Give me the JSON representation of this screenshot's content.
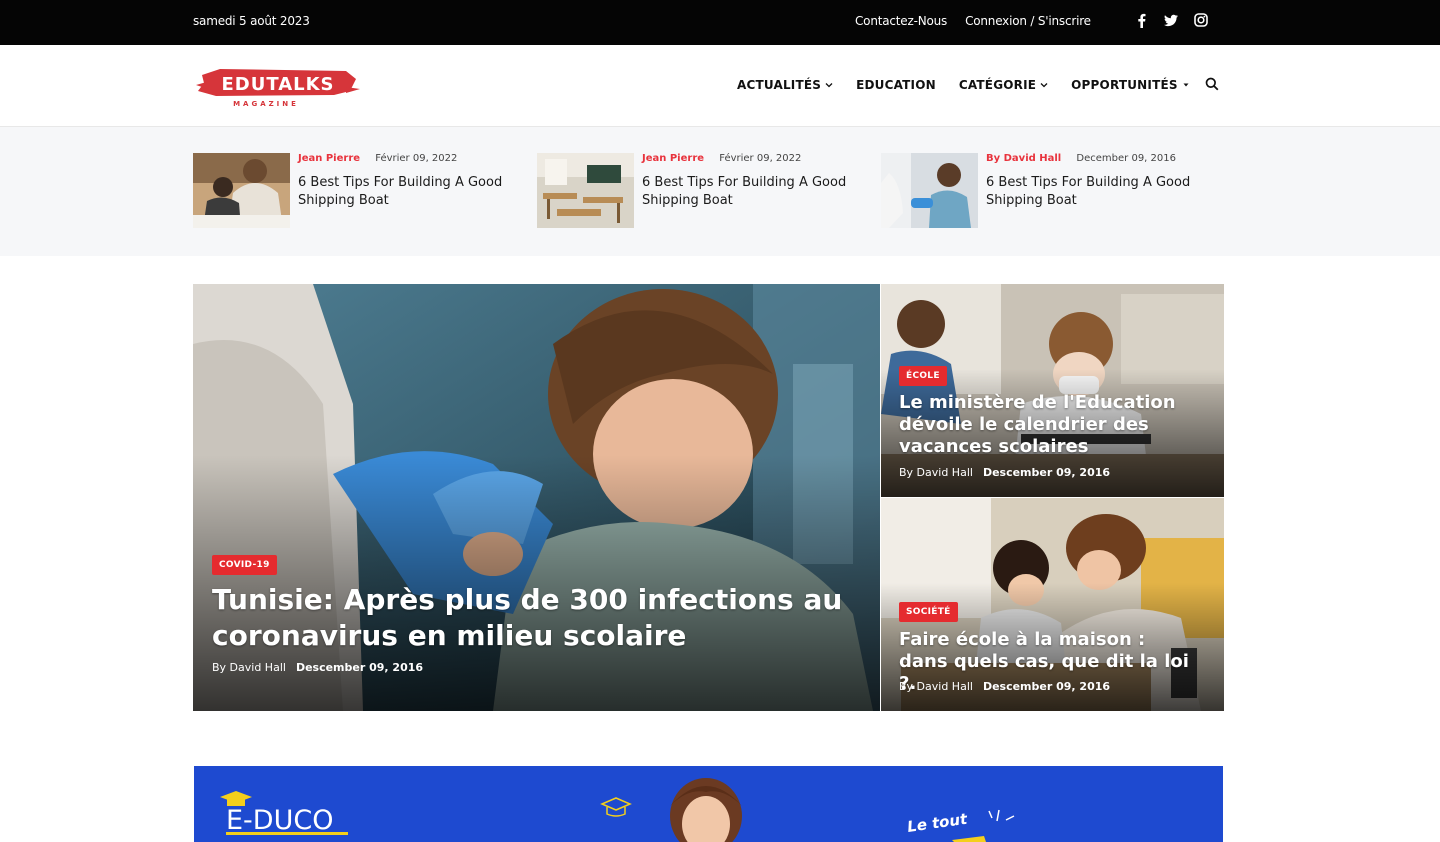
{
  "topbar": {
    "date": "samedi 5 août 2023",
    "contact": "Contactez-Nous",
    "login": "Connexion / S'inscrire",
    "social": [
      "facebook-icon",
      "twitter-icon",
      "instagram-icon"
    ]
  },
  "header": {
    "logo_text": "EDUTALKS",
    "logo_sub": "MAGAZINE",
    "nav": [
      {
        "label": "ACTUALITÉS",
        "icon": "chevron-down-icon"
      },
      {
        "label": "EDUCATION",
        "icon": ""
      },
      {
        "label": "CATÉGORIE",
        "icon": "chevron-down-icon"
      },
      {
        "label": "OPPORTUNITÉS",
        "icon": "caret-down-icon"
      }
    ],
    "search_icon": "search-icon"
  },
  "ticker": [
    {
      "author": "Jean Pierre",
      "date": "Février 09, 2022",
      "title": "6 Best Tips For Building A Good Shipping Boat"
    },
    {
      "author": "Jean Pierre",
      "date": "Février 09, 2022",
      "title": "6 Best Tips For Building A Good Shipping Boat"
    },
    {
      "author": "By David Hall",
      "date": "December 09, 2016",
      "title": "6 Best Tips For Building A Good Shipping Boat"
    }
  ],
  "hero": {
    "category": "COVID-19",
    "title": "Tunisie: Après plus de 300 infections au coronavirus en milieu scolaire",
    "author": "By David Hall",
    "date": "Descember 09, 2016"
  },
  "side": [
    {
      "category": "ÉCOLE",
      "title": "Le ministère de l'Education dévoile le calendrier des vacances scolaires",
      "author": "By David Hall",
      "date": "Descember 09, 2016"
    },
    {
      "category": "SOCIÉTÉ",
      "title": "Faire école à la maison : dans quels cas, que dit la loi ?.",
      "author": "By David Hall",
      "date": "Descember 09, 2016"
    }
  ],
  "banner": {
    "brand": "E-DUCO",
    "tagline": "Le tout"
  },
  "colors": {
    "accent": "#e52b2f",
    "topbar": "#050505",
    "banner": "#1e4ad0"
  }
}
